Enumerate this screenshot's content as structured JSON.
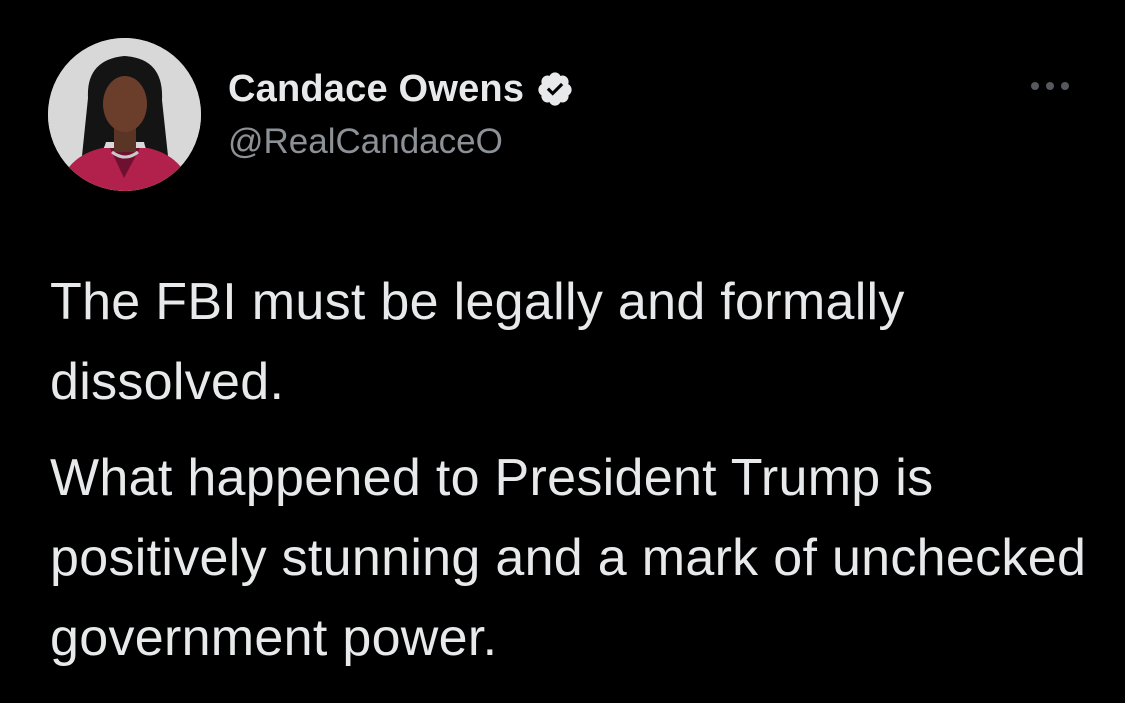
{
  "tweet": {
    "author": {
      "display_name": "Candace Owens",
      "handle": "@RealCandaceO",
      "verified": true,
      "avatar_icon": "profile-photo"
    },
    "menu_icon": "more-options-icon",
    "paragraphs": [
      "The FBI must be legally and formally dissolved.",
      "What happened to President Trump is positively stunning and a mark of unchecked government power."
    ]
  },
  "colors": {
    "background": "#000000",
    "text_primary": "#e7e9ea",
    "text_secondary": "#8b9196",
    "verified_badge": "#e7e9ea"
  }
}
